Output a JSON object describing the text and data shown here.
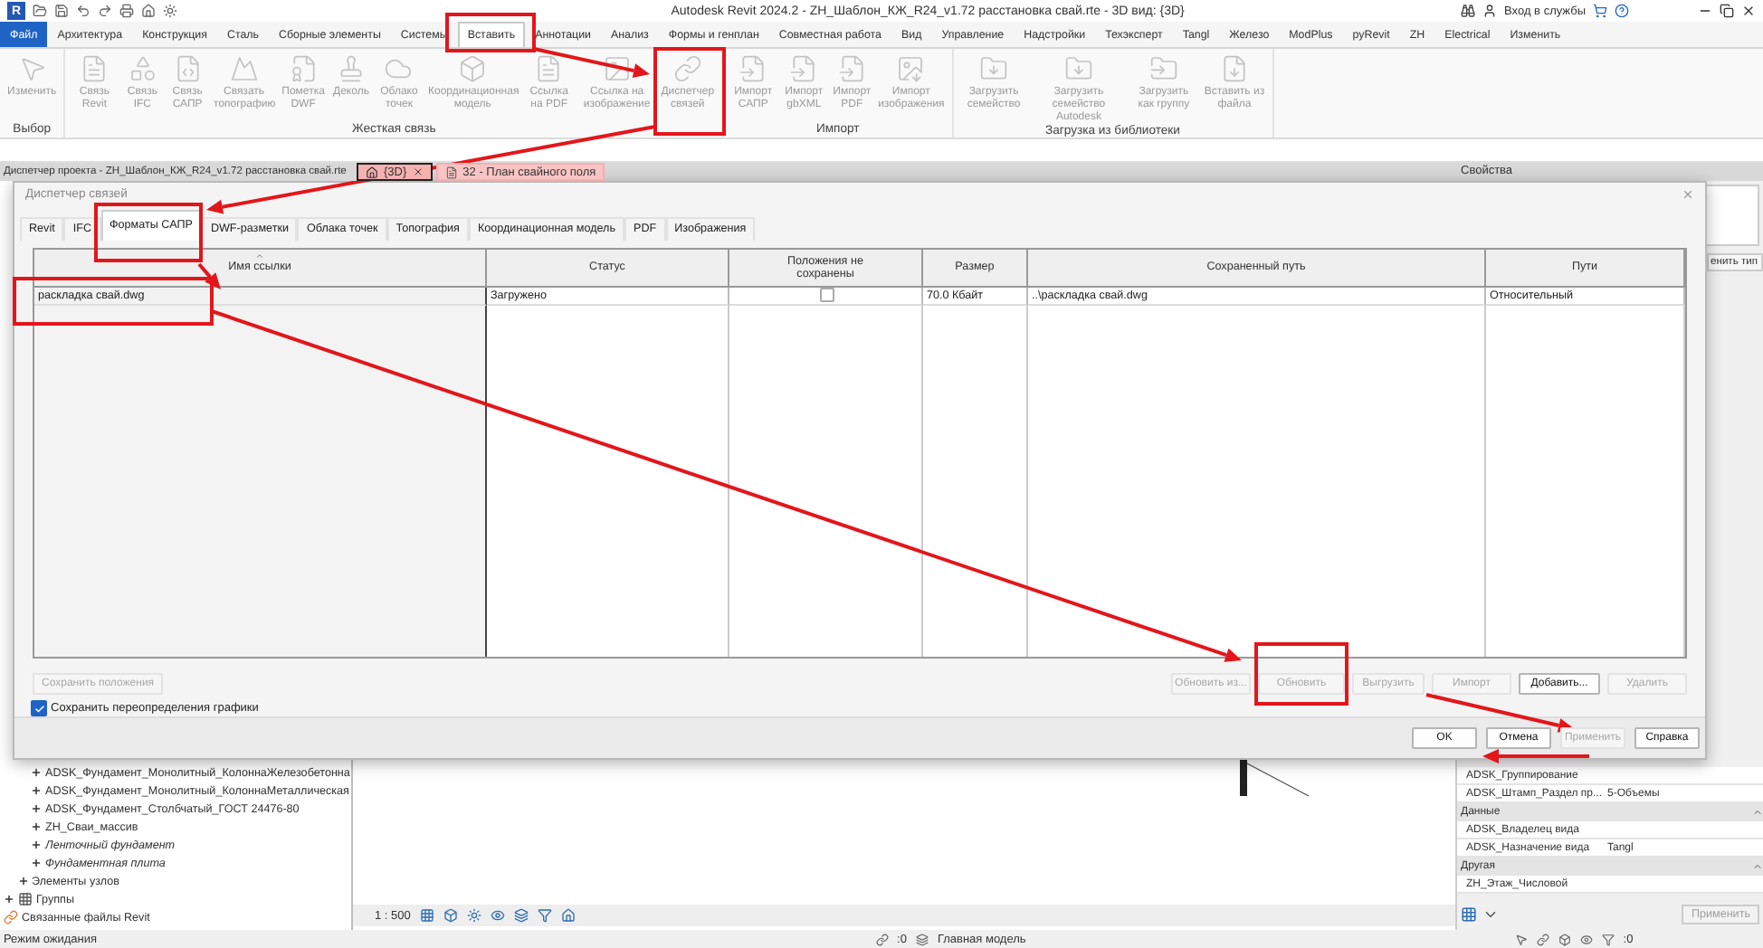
{
  "window": {
    "logo": "R",
    "title": "Autodesk Revit 2024.2 - ZH_Шаблон_КЖ_R24_v1.72 расстановка свай.rte - 3D вид: {3D}",
    "sign_in": "Вход в службы"
  },
  "menu_tabs": [
    {
      "label": "Файл",
      "kind": "file",
      "selected": false
    },
    {
      "label": "Архитектура",
      "kind": "tab",
      "selected": false
    },
    {
      "label": "Конструкция",
      "kind": "tab",
      "selected": false
    },
    {
      "label": "Сталь",
      "kind": "tab",
      "selected": false
    },
    {
      "label": "Сборные элементы",
      "kind": "tab",
      "selected": false
    },
    {
      "label": "Системы",
      "kind": "tab",
      "selected": false
    },
    {
      "label": "Вставить",
      "kind": "tab",
      "selected": true
    },
    {
      "label": "Аннотации",
      "kind": "tab",
      "selected": false
    },
    {
      "label": "Анализ",
      "kind": "tab",
      "selected": false
    },
    {
      "label": "Формы и генплан",
      "kind": "tab",
      "selected": false
    },
    {
      "label": "Совместная работа",
      "kind": "tab",
      "selected": false
    },
    {
      "label": "Вид",
      "kind": "tab",
      "selected": false
    },
    {
      "label": "Управление",
      "kind": "tab",
      "selected": false
    },
    {
      "label": "Надстройки",
      "kind": "tab",
      "selected": false
    },
    {
      "label": "Техэксперт",
      "kind": "tab",
      "selected": false
    },
    {
      "label": "Tangl",
      "kind": "tab",
      "selected": false
    },
    {
      "label": "Железо",
      "kind": "tab",
      "selected": false
    },
    {
      "label": "ModPlus",
      "kind": "tab",
      "selected": false
    },
    {
      "label": "pyRevit",
      "kind": "tab",
      "selected": false
    },
    {
      "label": "ZH",
      "kind": "tab",
      "selected": false
    },
    {
      "label": "Electrical",
      "kind": "tab",
      "selected": false
    },
    {
      "label": "Изменить",
      "kind": "tab",
      "selected": false
    }
  ],
  "ribbon_panels": [
    {
      "title": "Выбор",
      "buttons": [
        {
          "label": "Изменить",
          "disabled": true
        }
      ]
    },
    {
      "title": "Жесткая связь",
      "buttons": [
        {
          "label": "Связь Revit",
          "disabled": true
        },
        {
          "label": "Связь IFC",
          "disabled": true
        },
        {
          "label": "Связь САПР",
          "disabled": true
        },
        {
          "label": "Связать топографию",
          "disabled": true
        },
        {
          "label": "Пометка DWF",
          "disabled": true
        },
        {
          "label": "Деколь",
          "disabled": true
        },
        {
          "label": "Облако точек",
          "disabled": true
        },
        {
          "label": "Координационная модель",
          "disabled": true
        },
        {
          "label": "Ссылка на PDF",
          "disabled": true
        },
        {
          "label": "Ссылка на изображение",
          "disabled": true
        },
        {
          "label": "Диспетчер связей",
          "disabled": true
        }
      ]
    },
    {
      "title": "Импорт",
      "buttons": [
        {
          "label": "Импорт САПР",
          "disabled": true
        },
        {
          "label": "Импорт gbXML",
          "disabled": true
        },
        {
          "label": "Импорт PDF",
          "disabled": true
        },
        {
          "label": "Импорт изображения",
          "disabled": true
        }
      ]
    },
    {
      "title": "Загрузка из библиотеки",
      "buttons": [
        {
          "label": "Загрузить семейство",
          "disabled": true
        },
        {
          "label": "Загрузить семейство Autodesk",
          "disabled": true
        },
        {
          "label": "Загрузить как группу",
          "disabled": true
        },
        {
          "label": "Вставить из файла",
          "disabled": true
        }
      ]
    }
  ],
  "project_browser": {
    "title": "Диспетчер проекта - ZH_Шаблон_КЖ_R24_v1.72 расстановка свай.rte",
    "tree": [
      {
        "children": [
          {
            "children": [
              {
                "label": "ADSK_Фундамент_Монолитный_КолоннаЖелезобетонна",
                "kind": "family",
                "expanded": false
              },
              {
                "label": "ADSK_Фундамент_Монолитный_КолоннаМеталлическая",
                "kind": "family",
                "expanded": false
              },
              {
                "label": "ADSK_Фундамент_Столбчатый_ГОСТ 24476-80",
                "kind": "family",
                "expanded": false
              },
              {
                "label": "ZH_Сваи_массив",
                "kind": "family",
                "expanded": false
              },
              {
                "label": "Ленточный фундамент",
                "kind": "system_family",
                "expanded": false
              },
              {
                "label": "Фундаментная плита",
                "kind": "system_family",
                "expanded": false
              }
            ]
          },
          {
            "label": "Элементы узлов",
            "kind": "family",
            "expanded": false
          }
        ]
      },
      {
        "label": "Группы",
        "kind": "group",
        "expanded": false
      },
      {
        "label": "Связанные файлы Revit",
        "kind": "links"
      }
    ]
  },
  "view_tabs": [
    {
      "label": "{3D}",
      "selected": true
    },
    {
      "label": "32 - План свайного поля",
      "selected": false
    }
  ],
  "view": {
    "scale": "1 : 500"
  },
  "properties": {
    "title": "Свойства",
    "edit_type": "енить тип",
    "rows": [
      {
        "kind": "row",
        "name": "ADSK_Группирование"
      },
      {
        "kind": "row",
        "name": "ADSK_Штамп_Раздел пр...",
        "value": "5-Объемы"
      },
      {
        "kind": "group",
        "name": "Данные"
      },
      {
        "kind": "row",
        "name": "ADSK_Владелец вида"
      },
      {
        "kind": "row",
        "name": "ADSK_Назначение вида",
        "value": "Tangl"
      },
      {
        "kind": "group",
        "name": "Другая"
      },
      {
        "kind": "row",
        "name": "ZH_Этаж_Числовой"
      }
    ],
    "apply": "Применить"
  },
  "dialog": {
    "title": "Диспетчер связей",
    "tabs": [
      {
        "label": "Revit",
        "selected": false
      },
      {
        "label": "IFC",
        "selected": false
      },
      {
        "label": "Форматы САПР",
        "selected": true
      },
      {
        "label": "DWF-разметки",
        "selected": false
      },
      {
        "label": "Облака точек",
        "selected": false
      },
      {
        "label": "Топография",
        "selected": false
      },
      {
        "label": "Координационная модель",
        "selected": false
      },
      {
        "label": "PDF",
        "selected": false
      },
      {
        "label": "Изображения",
        "selected": false
      }
    ],
    "columns": [
      "Имя ссылки",
      "Статус",
      "Положения не сохранены",
      "Размер",
      "Сохраненный путь",
      "Пути"
    ],
    "rows": [
      {
        "name": "раскладка свай.dwg",
        "status": "Загружено",
        "positions_not_saved": false,
        "size": "70.0 Кбайт",
        "saved_path": "..\\раскладка свай.dwg",
        "path_type": "Относительный"
      }
    ],
    "save_positions": {
      "label": "Сохранить положения",
      "disabled": true
    },
    "actions": [
      {
        "label": "Обновить из...",
        "disabled": true
      },
      {
        "label": "Обновить",
        "disabled": true
      },
      {
        "label": "Выгрузить",
        "disabled": true
      },
      {
        "label": "Импорт",
        "disabled": true
      },
      {
        "label": "Добавить...",
        "disabled": false
      },
      {
        "label": "Удалить",
        "disabled": true
      }
    ],
    "keep_overrides": {
      "label": "Сохранить переопределения графики",
      "checked": true
    },
    "footer_buttons": [
      {
        "label": "OK",
        "disabled": false
      },
      {
        "label": "Отмена",
        "disabled": false
      },
      {
        "label": "Применить",
        "disabled": true
      },
      {
        "label": "Справка",
        "disabled": false
      }
    ]
  },
  "status_bar": {
    "text": "Режим ожидания",
    "count_1": ":0",
    "model": "Главная модель",
    "count_2": ":0"
  }
}
